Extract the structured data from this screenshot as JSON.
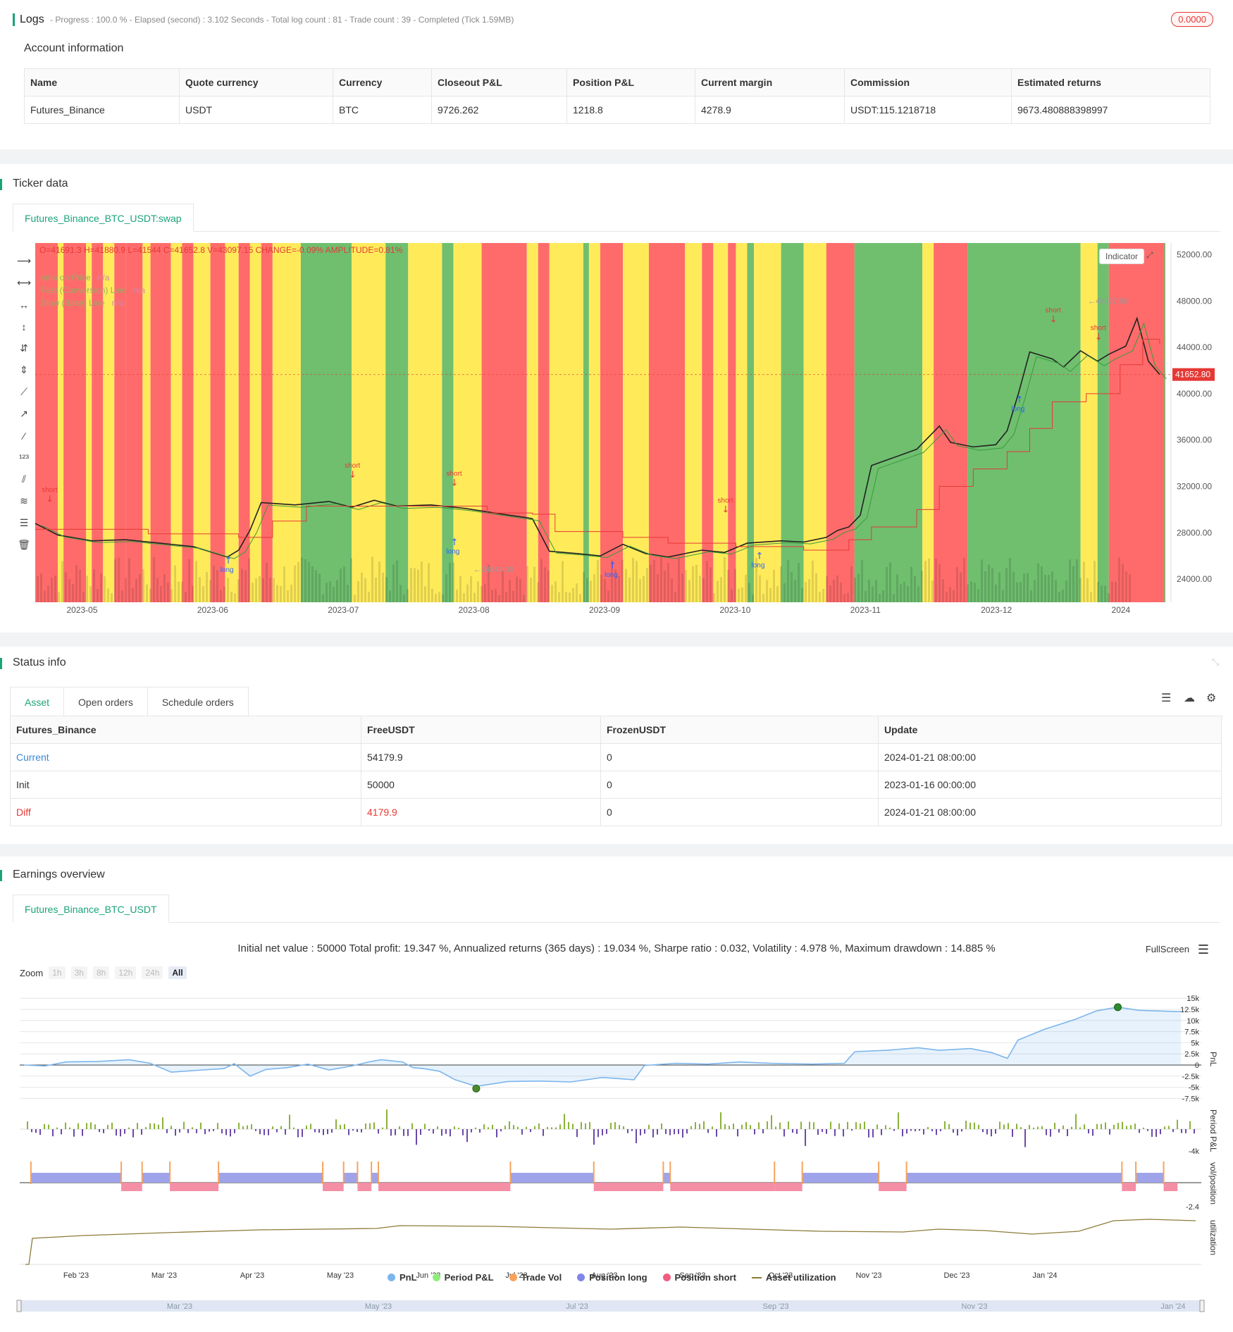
{
  "logs": {
    "title": "Logs",
    "meta": "- Progress : 100.0 % - Elapsed (second) : 3.102  Seconds - Total log count : 81 - Trade count : 39 - Completed (Tick 1.59MB)",
    "badge": "0.0000"
  },
  "account": {
    "title": "Account information",
    "headers": [
      "Name",
      "Quote currency",
      "Currency",
      "Closeout P&L",
      "Position P&L",
      "Current margin",
      "Commission",
      "Estimated returns"
    ],
    "row": [
      "Futures_Binance",
      "USDT",
      "BTC",
      "9726.262",
      "1218.8",
      "4278.9",
      "USDT:115.1218718",
      "9673.480888398997"
    ]
  },
  "ticker": {
    "title": "Ticker data",
    "tab": "Futures_Binance_BTC_USDT:swap",
    "ohlc": "O=41691.3 H=41880.9 L=41544 C=41652.8 V=43097.15 CHANGE=-0.09% AMPLITUDE=0.81%",
    "indicator_button": "Indicator",
    "legend": [
      {
        "name": "ema on Price",
        "value": "n/a"
      },
      {
        "name": "Fast (Conversion) Line",
        "value": "n/a"
      },
      {
        "name": "Slow (Base) Line",
        "value": "n/a"
      }
    ],
    "price_label": "41652.80",
    "high_label": "48027.50",
    "low_label": "24844.00",
    "y_ticks": [
      "52000.00",
      "48000.00",
      "44000.00",
      "40000.00",
      "36000.00",
      "32000.00",
      "28000.00",
      "24000.00"
    ],
    "x_ticks": [
      "2023-05",
      "2023-06",
      "2023-07",
      "2023-08",
      "2023-09",
      "2023-10",
      "2023-11",
      "2023-12",
      "2024"
    ],
    "colors": {
      "red": "#ff6b6b",
      "green": "#6fbf6f",
      "yellow": "#ffeb5a"
    }
  },
  "status": {
    "title": "Status info",
    "tabs": [
      "Asset",
      "Open orders",
      "Schedule orders"
    ],
    "headers": [
      "Futures_Binance",
      "FreeUSDT",
      "FrozenUSDT",
      "Update"
    ],
    "rows": [
      [
        "Current",
        "54179.9",
        "0",
        "2024-01-21 08:00:00"
      ],
      [
        "Init",
        "50000",
        "0",
        "2023-01-16 00:00:00"
      ],
      [
        "Diff",
        "4179.9",
        "0",
        "2024-01-21 08:00:00"
      ]
    ]
  },
  "earnings": {
    "title": "Earnings overview",
    "tab": "Futures_Binance_BTC_USDT",
    "summary": "Initial net value : 50000 Total profit: 19.347 %, Annualized returns (365 days) : 19.034 %, Sharpe ratio : 0.032, Volatility : 4.978 %, Maximum drawdown : 14.885 %",
    "fullscreen": "FullScreen",
    "zoom_label": "Zoom",
    "zoom_buttons": [
      "1h",
      "3h",
      "8h",
      "12h",
      "24h",
      "All"
    ],
    "pnl_ticks": [
      "15k",
      "12.5k",
      "10k",
      "7.5k",
      "5k",
      "2.5k",
      "0",
      "-2.5k",
      "-5k",
      "-7.5k"
    ],
    "period_tick": "-4k",
    "pos_tick": "-2.4",
    "axis_titles": [
      "PnL",
      "Period P&L",
      "vol/position",
      "utilization"
    ],
    "x_ticks": [
      "Feb '23",
      "Mar '23",
      "Apr '23",
      "May '23",
      "Jun '23",
      "Jul '23",
      "Aug '23",
      "Sep '23",
      "Oct '23",
      "Nov '23",
      "Dec '23",
      "Jan '24"
    ],
    "nav_ticks": [
      "Mar '23",
      "May '23",
      "Jul '23",
      "Sep '23",
      "Nov '23",
      "Jan '24"
    ],
    "legend": [
      {
        "name": "PnL",
        "color": "#7cb5ec"
      },
      {
        "name": "Period P&L",
        "color": "#90ed7d"
      },
      {
        "name": "Trade Vol",
        "color": "#f7a35c"
      },
      {
        "name": "Position long",
        "color": "#8085e9"
      },
      {
        "name": "Position short",
        "color": "#f15c80"
      },
      {
        "name": "Asset utilization",
        "color": "#8d7b3a"
      }
    ]
  }
}
